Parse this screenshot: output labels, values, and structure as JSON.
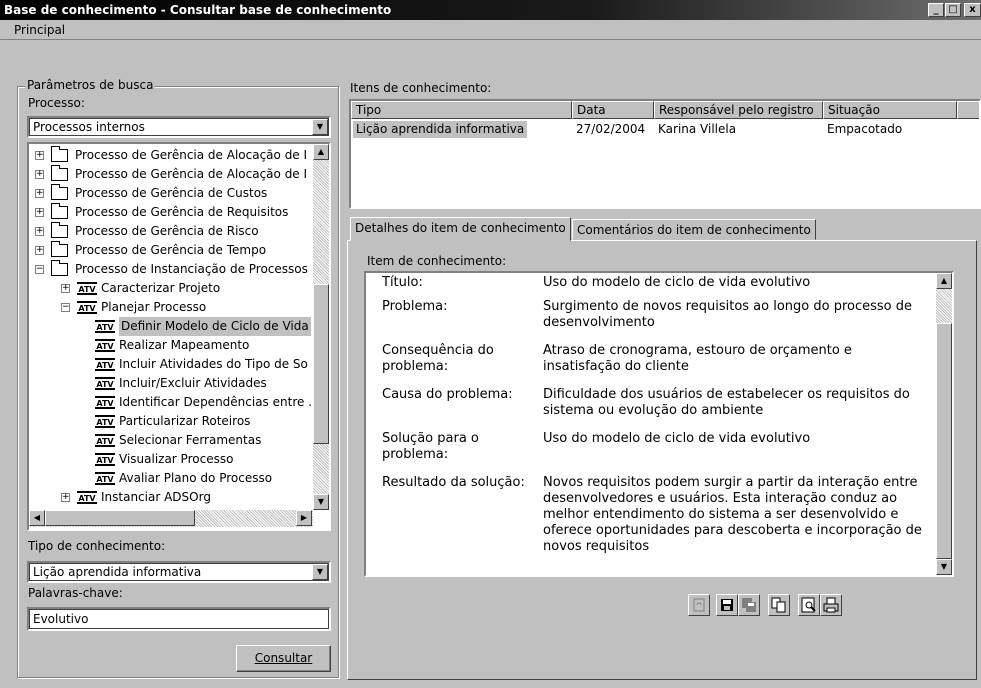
{
  "window": {
    "title": "Base de conhecimento - Consultar base de conhecimento",
    "min_glyph": "_",
    "max_glyph": "□",
    "close_glyph": "x"
  },
  "menu": {
    "principal": "Principal"
  },
  "search": {
    "group_label": "Parâmetros de busca",
    "processo_label": "Processo:",
    "processo_value": "Processos internos",
    "tree_items": [
      {
        "label": "Processo de Gerência de Alocação de I",
        "type": "folder",
        "level": 0,
        "expander": "+"
      },
      {
        "label": "Processo de Gerência de Alocação de I",
        "type": "folder",
        "level": 0,
        "expander": "+"
      },
      {
        "label": "Processo de Gerência de Custos",
        "type": "folder",
        "level": 0,
        "expander": "+"
      },
      {
        "label": "Processo de Gerência de Requisitos",
        "type": "folder",
        "level": 0,
        "expander": "+"
      },
      {
        "label": "Processo de Gerência de Risco",
        "type": "folder",
        "level": 0,
        "expander": "+"
      },
      {
        "label": "Processo de Gerência de Tempo",
        "type": "folder",
        "level": 0,
        "expander": "+"
      },
      {
        "label": "Processo de Instanciação de Processos",
        "type": "folder",
        "level": 0,
        "expander": "−"
      },
      {
        "label": "Caracterizar Projeto",
        "type": "atv",
        "level": 1,
        "expander": "+"
      },
      {
        "label": "Planejar Processo",
        "type": "atv",
        "level": 1,
        "expander": "−"
      },
      {
        "label": "Definir Modelo de Ciclo de Vida",
        "type": "atv",
        "level": 2,
        "expander": "",
        "selected": true
      },
      {
        "label": "Realizar Mapeamento",
        "type": "atv",
        "level": 2,
        "expander": ""
      },
      {
        "label": "Incluir Atividades do Tipo de So",
        "type": "atv",
        "level": 2,
        "expander": ""
      },
      {
        "label": "Incluir/Excluir Atividades",
        "type": "atv",
        "level": 2,
        "expander": ""
      },
      {
        "label": "Identificar Dependências entre .",
        "type": "atv",
        "level": 2,
        "expander": ""
      },
      {
        "label": "Particularizar Roteiros",
        "type": "atv",
        "level": 2,
        "expander": ""
      },
      {
        "label": "Selecionar Ferramentas",
        "type": "atv",
        "level": 2,
        "expander": ""
      },
      {
        "label": "Visualizar Processo",
        "type": "atv",
        "level": 2,
        "expander": ""
      },
      {
        "label": "Avaliar Plano do Processo",
        "type": "atv",
        "level": 2,
        "expander": ""
      },
      {
        "label": "Instanciar ADSOrg",
        "type": "atv",
        "level": 1,
        "expander": "+"
      }
    ],
    "atv_icon_text": "ATV",
    "tipo_label": "Tipo de conhecimento:",
    "tipo_value": "Lição aprendida informativa",
    "palavras_label": "Palavras-chave:",
    "palavras_value": "Evolutivo",
    "consultar_button": "Consultar"
  },
  "items": {
    "label": "Itens de conhecimento:",
    "columns": [
      "Tipo",
      "Data",
      "Responsável pelo registro",
      "Situação"
    ],
    "rows": [
      {
        "tipo": "Lição aprendida informativa",
        "data": "27/02/2004",
        "responsavel": "Karina Villela",
        "situacao": "Empacotado"
      }
    ]
  },
  "tabs": [
    {
      "label": "Detalhes do item de conhecimento",
      "active": true
    },
    {
      "label": "Comentários do item de conhecimento",
      "active": false
    }
  ],
  "details": {
    "group_label": "Item de conhecimento:",
    "fields": [
      {
        "label": "Título:",
        "value": "Uso do modelo de ciclo de vida evolutivo"
      },
      {
        "label": "Problema:",
        "value": "Surgimento de novos requisitos ao longo do processo de desenvolvimento"
      },
      {
        "label": "Consequência do problema:",
        "value": "Atraso de cronograma, estouro de orçamento e insatisfação do cliente"
      },
      {
        "label": "Causa do problema:",
        "value": "Dificuldade dos usuários de estabelecer os requisitos do sistema ou evolução do ambiente"
      },
      {
        "label": "Solução para o problema:",
        "value": "Uso do modelo de ciclo de vida evolutivo"
      },
      {
        "label": "Resultado da solução:",
        "value": "Novos requisitos podem surgir a partir da interação entre desenvolvedores e usuários. Esta interação conduz ao melhor entendimento do sistema a ser desenvolvido e oferece oportunidades para descoberta e incorporação de novos requisitos"
      }
    ]
  },
  "toolbar": [
    "refresh-icon",
    "save-icon",
    "save-all-icon",
    "copy-icon",
    "print-preview-icon",
    "print-icon"
  ]
}
